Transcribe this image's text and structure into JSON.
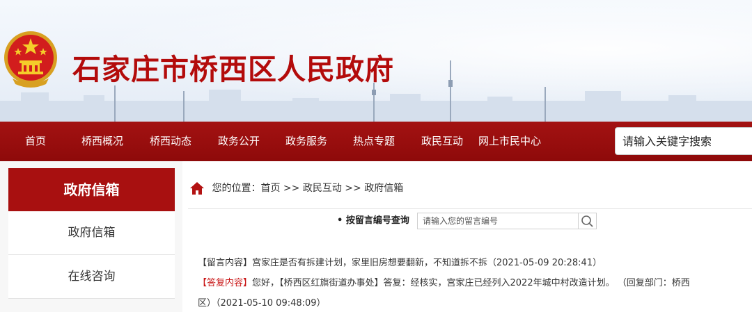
{
  "header": {
    "site_title": "石家庄市桥西区人民政府"
  },
  "nav": {
    "items": [
      "首页",
      "桥西概况",
      "桥西动态",
      "政务公开",
      "政务服务",
      "热点专题",
      "政民互动",
      "网上市民中心"
    ],
    "search_placeholder": "请输入关键字搜索"
  },
  "sidebar": {
    "header": "政府信箱",
    "items": [
      "政府信箱",
      "在线咨询"
    ]
  },
  "breadcrumb": {
    "prefix": "您的位置：",
    "home": "首页",
    "sep1": " >> ",
    "level2": "政民互动",
    "sep2": " >> ",
    "current": "政府信箱"
  },
  "query": {
    "label": "• 按留言编号查询",
    "placeholder": "请输入您的留言编号"
  },
  "message": {
    "content_tag": "【留言内容】",
    "content_text": "宫家庄是否有拆建计划，家里旧房想要翻新，不知道拆不拆（2021-05-09 20:28:41）",
    "reply_tag": "【答复内容】",
    "reply_text_line1": "您好，【桥西区红旗街道办事处】答复：经核实，宫家庄已经列入2022年城中村改造计划。 （回复部门：桥西",
    "reply_text_line2": "区）（2021-05-10 09:48:09）"
  },
  "colors": {
    "brand_red": "#a81010",
    "nav_red": "#9a0e0e",
    "reply_tag_red": "#c81414"
  },
  "icons": {
    "home": "home-icon",
    "search": "search-icon",
    "emblem": "national-emblem-icon"
  }
}
